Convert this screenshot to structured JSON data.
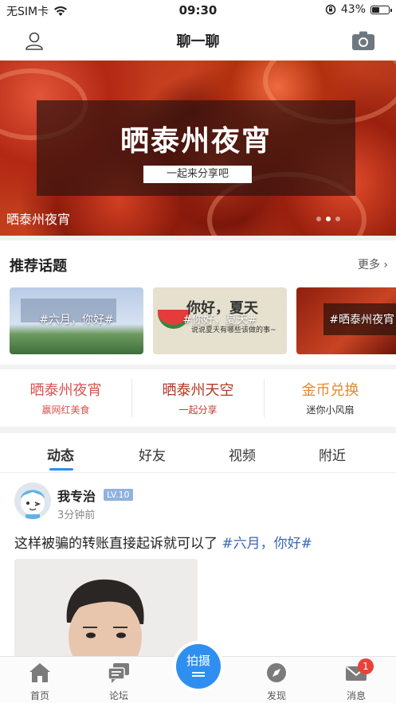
{
  "status_bar": {
    "carrier": "无SIM卡",
    "time": "09:30",
    "battery_percent_label": "43%",
    "battery_level": 0.43
  },
  "nav": {
    "title": "聊一聊",
    "left_icon": "user-icon",
    "right_icon": "camera-icon"
  },
  "banner": {
    "headline": "晒泰州夜宵",
    "tagline": "一起来分享吧",
    "caption": "晒泰州夜宵",
    "dot_count": 3,
    "active_dot": 1
  },
  "topics": {
    "title": "推荐话题",
    "more_label": "更多",
    "cards": [
      {
        "label": "#六月，你好#"
      },
      {
        "label": "#你好，夏天#",
        "image_title": "你好，夏天",
        "image_subtitle": "说说夏天有哪些该做的事~"
      },
      {
        "label": "#晒泰州夜宵"
      }
    ]
  },
  "quick_entries": [
    {
      "title": "晒泰州夜宵",
      "subtitle": "赢网红美食",
      "title_color": "#d9544f",
      "subtitle_color": "#d9544f"
    },
    {
      "title": "晒泰州天空",
      "subtitle": "一起分享",
      "title_color": "#b03a26",
      "subtitle_color": "#c0392b"
    },
    {
      "title": "金币兑换",
      "subtitle": "迷你小风扇",
      "title_color": "#e08a2e",
      "subtitle_color": "#333333"
    }
  ],
  "tabs": [
    {
      "label": "动态",
      "active": true
    },
    {
      "label": "好友",
      "active": false
    },
    {
      "label": "视频",
      "active": false
    },
    {
      "label": "附近",
      "active": false
    }
  ],
  "post": {
    "username": "我专治",
    "level": "LV.10",
    "time": "3分钟前",
    "text": "这样被骗的转账直接起诉就可以了 ",
    "hashtag": "#六月，你好#"
  },
  "tabbar": {
    "items": [
      {
        "label": "首页",
        "icon": "home-icon"
      },
      {
        "label": "论坛",
        "icon": "forum-icon"
      },
      {
        "label": "发现",
        "icon": "compass-icon"
      },
      {
        "label": "消息",
        "icon": "mail-icon"
      }
    ],
    "center_label": "拍摄",
    "message_badge": "1"
  },
  "colors": {
    "accent": "#2f8ff0",
    "hashtag": "#3a67b5",
    "badge": "#e8423b"
  }
}
